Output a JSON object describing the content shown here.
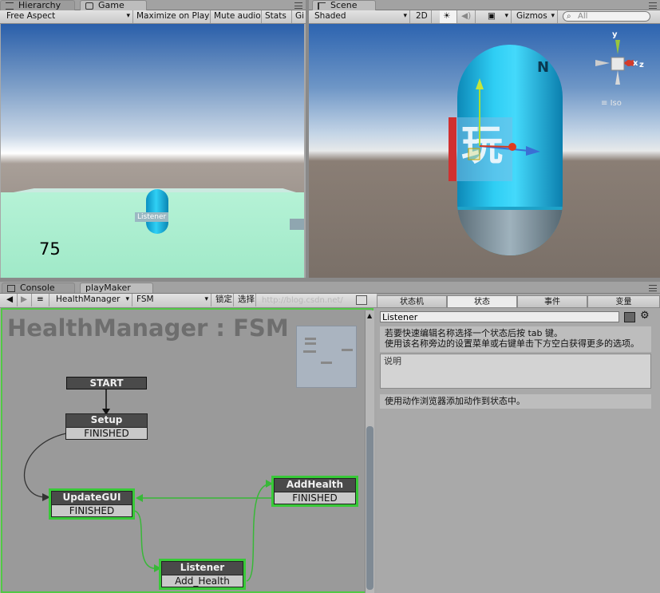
{
  "game_panel": {
    "tab_hierarchy": "Hierarchy",
    "tab_game": "Game",
    "aspect": "Free Aspect",
    "maximize": "Maximize on Play",
    "mute": "Mute audio",
    "stats": "Stats",
    "gizmos_cut": "Gi",
    "object_label": "Listener",
    "health_value": "75"
  },
  "scene_panel": {
    "tab_scene": "Scene",
    "shading": "Shaded",
    "mode_2d": "2D",
    "gizmos": "Gizmos",
    "search_placeholder": "All",
    "axis_x": "x",
    "axis_y": "y",
    "axis_z": "z",
    "projection": "Iso"
  },
  "bottom_tabs": {
    "console": "Console",
    "playmaker": "playMaker"
  },
  "fsm_toolbar": {
    "owner": "HealthManager",
    "fsm": "FSM",
    "lock": "锁定",
    "select": "选择"
  },
  "fsm_graph": {
    "title": "HealthManager : FSM",
    "start_label": "START",
    "states": [
      {
        "name": "Setup",
        "event": "FINISHED"
      },
      {
        "name": "UpdateGUI",
        "event": "FINISHED"
      },
      {
        "name": "AddHealth",
        "event": "FINISHED"
      },
      {
        "name": "Listener",
        "event": "Add_Health"
      }
    ]
  },
  "inspector": {
    "tabs": [
      "状态机",
      "状态",
      "事件",
      "变量"
    ],
    "active_tab": "状态",
    "state_name": "Listener",
    "hint_line1": "若要快速编辑名称选择一个状态后按 tab 键。",
    "hint_line2": "使用该名称旁边的设置菜单或右键单击下方空白获得更多的选项。",
    "description_placeholder": "说明",
    "actions_hint": "使用动作浏览器添加动作到状态中。"
  },
  "watermark": "http://blog.csdn.net/",
  "colors": {
    "selection_green": "#38c938",
    "capsule_cyan": "#27c6ef",
    "state_header": "#4a4a4a"
  }
}
